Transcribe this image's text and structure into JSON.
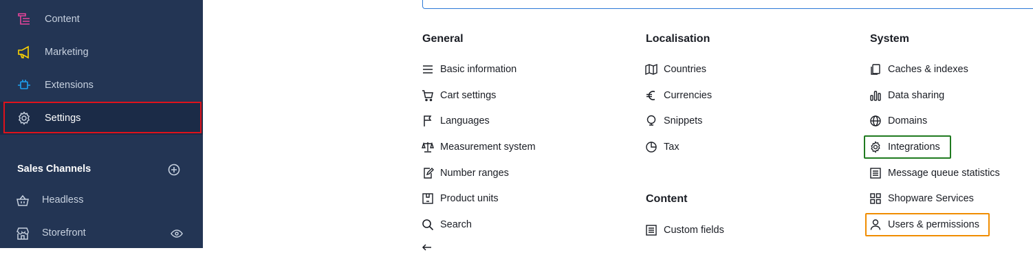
{
  "sidebar": {
    "items": [
      {
        "label": "Content",
        "icon": "content-icon",
        "color": "#e8459b"
      },
      {
        "label": "Marketing",
        "icon": "megaphone-icon",
        "color": "#ffd500"
      },
      {
        "label": "Extensions",
        "icon": "plug-icon",
        "color": "#1da1f2"
      },
      {
        "label": "Settings",
        "icon": "gear-icon",
        "color": "#c7d1df",
        "active": true
      }
    ],
    "sales_channels_title": "Sales Channels",
    "channels": [
      {
        "label": "Headless",
        "icon": "basket-icon"
      },
      {
        "label": "Storefront",
        "icon": "storefront-icon"
      }
    ]
  },
  "settings": {
    "general": {
      "title": "General",
      "items": [
        "Basic information",
        "Cart settings",
        "Languages",
        "Measurement system",
        "Number ranges",
        "Product units",
        "Search"
      ]
    },
    "localisation": {
      "title": "Localisation",
      "items": [
        "Countries",
        "Currencies",
        "Snippets",
        "Tax"
      ]
    },
    "content": {
      "title": "Content",
      "items": [
        "Custom fields"
      ]
    },
    "system": {
      "title": "System",
      "items": [
        "Caches & indexes",
        "Data sharing",
        "Domains",
        "Integrations",
        "Message queue statistics",
        "Shopware Services",
        "Users & permissions"
      ]
    }
  },
  "colors": {
    "sidebar_bg": "#233554",
    "active_outline": "#e0121b",
    "highlight_green": "#1f7a1f",
    "highlight_orange": "#f08c00"
  }
}
